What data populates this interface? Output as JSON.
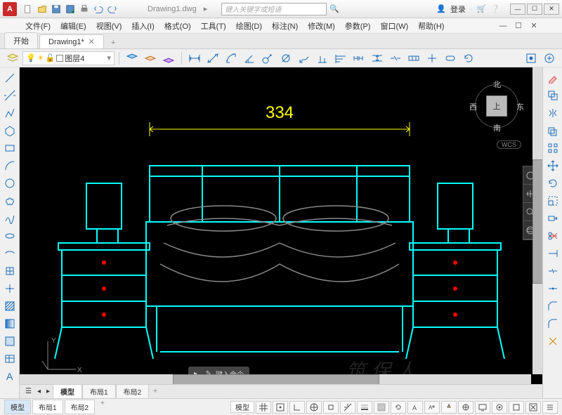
{
  "title": {
    "app": "A",
    "document": "Drawing1.dwg"
  },
  "search": {
    "placeholder": "键入关键字或短语"
  },
  "account": {
    "login": "登录"
  },
  "menubar": [
    "文件(F)",
    "编辑(E)",
    "视图(V)",
    "插入(I)",
    "格式(O)",
    "工具(T)",
    "绘图(D)",
    "标注(N)",
    "修改(M)",
    "参数(P)",
    "窗口(W)",
    "帮助(H)"
  ],
  "tabs": {
    "start": "开始",
    "doc": "Drawing1*"
  },
  "layer": {
    "name": "图层4"
  },
  "viewcube": {
    "top": "上",
    "n": "北",
    "s": "南",
    "e": "东",
    "w": "西",
    "wcs": "WCS"
  },
  "cmdline": {
    "prompt": "键入命令"
  },
  "layout_tabs": [
    "模型",
    "布局1",
    "布局2"
  ],
  "status_tabs": [
    "模型",
    "布局1",
    "布局2"
  ],
  "status_mode": "模型",
  "dimension": "334",
  "watermark": "筑 保 人"
}
